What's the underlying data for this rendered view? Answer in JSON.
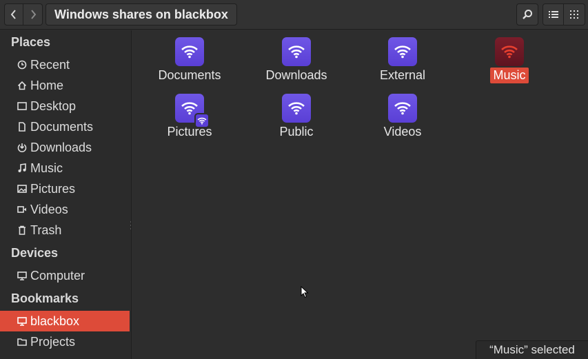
{
  "header": {
    "title": "Windows shares on blackbox",
    "back_icon": "chevron-left-icon",
    "forward_icon": "chevron-right-icon",
    "search_icon": "search-icon",
    "list_view_icon": "list-view-icon",
    "grid_view_icon": "grid-view-icon"
  },
  "sidebar": {
    "places_title": "Places",
    "places": [
      {
        "label": "Recent",
        "icon": "clock-icon"
      },
      {
        "label": "Home",
        "icon": "home-icon"
      },
      {
        "label": "Desktop",
        "icon": "desktop-icon"
      },
      {
        "label": "Documents",
        "icon": "document-icon"
      },
      {
        "label": "Downloads",
        "icon": "download-icon"
      },
      {
        "label": "Music",
        "icon": "music-icon"
      },
      {
        "label": "Pictures",
        "icon": "pictures-icon"
      },
      {
        "label": "Videos",
        "icon": "video-icon"
      },
      {
        "label": "Trash",
        "icon": "trash-icon"
      }
    ],
    "devices_title": "Devices",
    "devices": [
      {
        "label": "Computer",
        "icon": "computer-icon"
      }
    ],
    "bookmarks_title": "Bookmarks",
    "bookmarks": [
      {
        "label": "blackbox",
        "icon": "network-share-icon",
        "active": true
      },
      {
        "label": "Projects",
        "icon": "folder-icon"
      }
    ]
  },
  "files": [
    {
      "label": "Documents",
      "icon": "network-share-icon"
    },
    {
      "label": "Downloads",
      "icon": "network-share-icon"
    },
    {
      "label": "External",
      "icon": "network-share-icon"
    },
    {
      "label": "Music",
      "icon": "network-share-icon",
      "selected": true
    },
    {
      "label": "Pictures",
      "icon": "network-share-icon"
    },
    {
      "label": "Public",
      "icon": "network-share-icon"
    },
    {
      "label": "Videos",
      "icon": "network-share-icon"
    }
  ],
  "status": "“Music” selected",
  "colors": {
    "accent": "#dd4b39",
    "share_icon": "#5e44d9",
    "background": "#2d2d2d"
  }
}
